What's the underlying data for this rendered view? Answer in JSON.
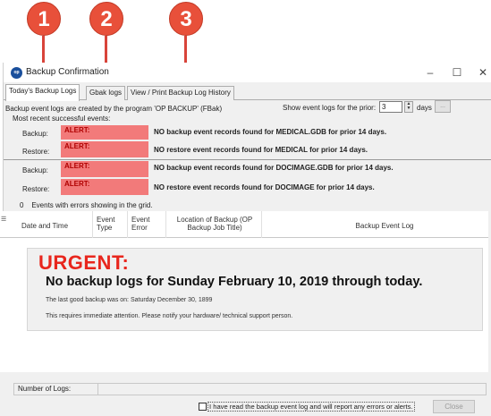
{
  "markers": [
    "1",
    "2",
    "3"
  ],
  "window": {
    "title": "Backup Confirmation",
    "icon_text": "op",
    "controls": {
      "minimize": "–",
      "maximize": "☐",
      "close": "✕"
    }
  },
  "tabs": [
    {
      "label": "Today's Backup Logs",
      "active": true
    },
    {
      "label": "Gbak logs",
      "active": false
    },
    {
      "label": "View / Print Backup Log History",
      "active": false
    }
  ],
  "info": {
    "created_by": "Backup event logs are created by the program 'OP BACKUP' (FBak)",
    "prior_label": "Show event logs for the prior:",
    "prior_value": "3",
    "days_label": "days",
    "browse_label": "...",
    "recent_label": "Most recent successful events:"
  },
  "groups": [
    {
      "rows": [
        {
          "label": "Backup:",
          "alert": "ALERT:",
          "message": "NO backup event records found for MEDICAL.GDB for prior 14 days."
        },
        {
          "label": "Restore:",
          "alert": "ALERT:",
          "message": "NO restore event records found for MEDICAL for prior 14 days."
        }
      ]
    },
    {
      "rows": [
        {
          "label": "Backup:",
          "alert": "ALERT:",
          "message": "NO backup event records found for DOCIMAGE.GDB for prior 14 days."
        },
        {
          "label": "Restore:",
          "alert": "ALERT:",
          "message": "NO restore event records found for DOCIMAGE for prior 14 days."
        }
      ]
    }
  ],
  "errors_line": {
    "count": "0",
    "text": "Events with errors showing in the grid."
  },
  "grid": {
    "columns": [
      {
        "label": "Date and Time"
      },
      {
        "label": "Event Type"
      },
      {
        "label": "Event Error"
      },
      {
        "label": "Location of Backup (OP Backup Job Title)"
      },
      {
        "label": "Backup Event Log"
      }
    ]
  },
  "urgent": {
    "title": "URGENT:",
    "main": "No backup logs for  Sunday  February 10, 2019 through today.",
    "last_good": "The last good backup was on:  Saturday  December 30, 1899",
    "notice": "This requires immediate attention. Please notify your hardware/ technical support person."
  },
  "footer": {
    "count_label": "Number of Logs:",
    "count_value": "",
    "acknowledge": "I have read the backup event log and will report any errors or alerts.",
    "close_label": "Close"
  },
  "colors": {
    "marker": "#e8503a",
    "alert_bg": "#f27a7a",
    "alert_text": "#b00000",
    "urgent_title": "#e8261d",
    "window_bg": "#f0f0f0"
  }
}
